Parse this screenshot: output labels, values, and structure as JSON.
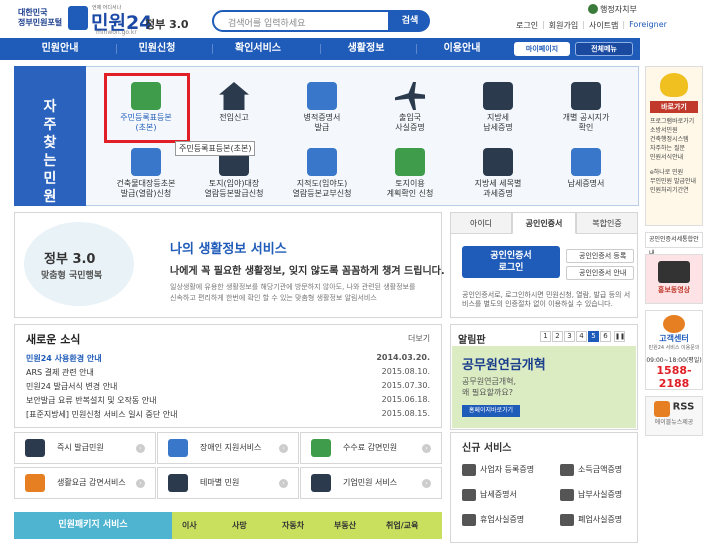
{
  "header": {
    "portal_name_line1": "대한민국",
    "portal_name_line2": "정부민원포털",
    "logo_tiny": "언제 어디서나",
    "brand": "민원24",
    "domain": "minwon.go.kr",
    "gov30": "정부 3.0",
    "search_placeholder": "검색어를 입력하세요",
    "search_button": "검색",
    "ministry": "행정자치부",
    "util_links": [
      "로그인",
      "회원가입",
      "사이트맵",
      "Foreigner"
    ]
  },
  "nav": {
    "items": [
      "민원안내",
      "민원신청",
      "확인서비스",
      "생활정보",
      "이용안내"
    ],
    "mypage": "마이페이지",
    "allmenu": "전체메뉴"
  },
  "quick": {
    "side_title": "자주 찾는 민원",
    "row1": [
      "주민등록표등본\n(초본)",
      "전입신고",
      "병적증명서\n발급",
      "출입국\n사실증명",
      "지방세\n납세증명",
      "개별 공시지가\n확인"
    ],
    "row2": [
      "건축물대장등초본\n발급(열람)신청",
      "토지(임야)대장\n열람등본발급신청",
      "지적도(임야도)\n열람등본교부신청",
      "토지이용\n계획확인 신청",
      "지방세 세목별\n과세증명",
      "납세증명서"
    ],
    "tooltip": "주민등록표등본(초본)"
  },
  "banner": {
    "gov30": "정부 3.0",
    "sub": "맞춤형 국민행복",
    "title": "나의 생활정보 서비스",
    "headline": "나에게 꼭 필요한 생활정보, 잊지 않도록 꼼꼼하게 챙겨 드립니다.",
    "desc1": "일상생활에 유용한 생활정보를 해당기관에 방문하지 않아도, 나와 관련된 생활정보를",
    "desc2": "신속하고 편리하게 한번에 확인 할 수 있는 맞춤형 생활정보 알림서비스"
  },
  "login": {
    "tabs": [
      "아이디",
      "공인인증서",
      "복합인증"
    ],
    "button_line1": "공인인증서",
    "button_line2": "로그인",
    "cert_register": "공인인증서 등록",
    "cert_guide": "공인인증서 안내",
    "note": "공인인증서로, 로그인하시면 민원신청, 열람, 발급 등의 서비스를 별도의 인증절차 없이 이용하실 수 있습니다."
  },
  "news": {
    "title": "새로운 소식",
    "more": "더보기",
    "items": [
      {
        "text": "민원24 사용환경 안내",
        "date": "2014.03.20."
      },
      {
        "text": "ARS 결제 관련 안내",
        "date": "2015.08.10."
      },
      {
        "text": "민원24 발급서식 변경 안내",
        "date": "2015.07.30."
      },
      {
        "text": "보안발급 요류 반복설치 및 오작동 안내",
        "date": "2015.06.18."
      },
      {
        "text": "[표준지방세] 민원신청 서비스 일시 중단 안내",
        "date": "2015.08.15."
      }
    ]
  },
  "board": {
    "title": "알림판",
    "pages": [
      "1",
      "2",
      "3",
      "4",
      "5",
      "6"
    ],
    "active_page": "5",
    "headline": "공무원연금개혁",
    "line1": "공무원연금개혁,",
    "line2": "왜 필요할까요?",
    "button": "홈페이지바로가기"
  },
  "services": [
    "즉시 발급민원",
    "장애인 지원서비스",
    "수수료 감면민원",
    "생활요금 감면서비스",
    "테마별 민원",
    "기업민원 서비스"
  ],
  "new_services": {
    "title": "신규 서비스",
    "items": [
      "사업자 등록증명",
      "소득금액증명",
      "납세증명서",
      "납부사실증명",
      "휴업사실증명",
      "폐업사실증명"
    ]
  },
  "package": {
    "label": "민원패키지 서비스",
    "items": [
      "이사",
      "사망",
      "자동차",
      "부동산",
      "취업/교육"
    ]
  },
  "rail": {
    "title": "바로가기",
    "links": [
      "프로그램바로가기",
      "소방서민원",
      "건축행정시스템",
      "자주하는 질문",
      "민원서식안내"
    ],
    "links2": [
      "e하나로 민원",
      "무인민원 발급안내",
      "민원처리기간연"
    ],
    "link3": "공인인증서세통합안내",
    "promo": "홍보동영상",
    "center_title": "고객센터",
    "center_sub": "민원24 서비스 이용문의",
    "hours": "09:00~18:00(평일)",
    "phone": "1588-2188",
    "rss": "RSS",
    "rss_sub": "에이블뉴스제공"
  }
}
